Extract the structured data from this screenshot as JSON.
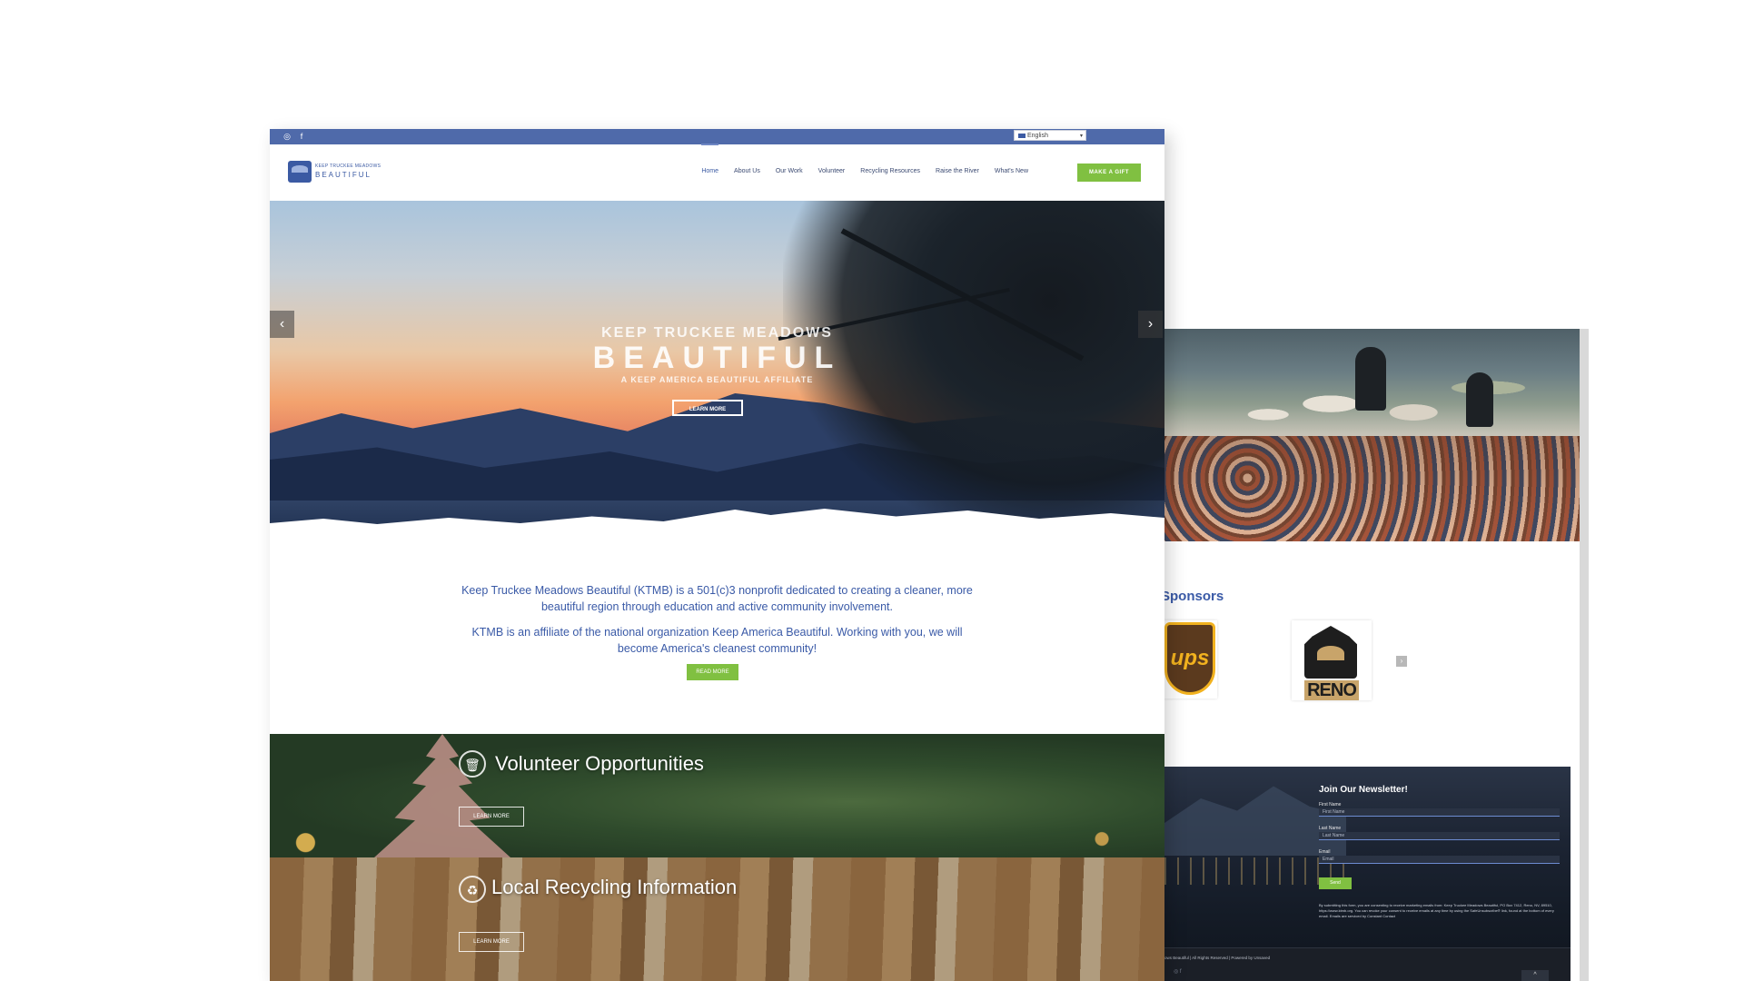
{
  "topbar": {
    "instagram_icon": "instagram-icon",
    "facebook_icon": "facebook-icon",
    "language": "English"
  },
  "logo": {
    "line1": "KEEP TRUCKEE MEADOWS",
    "line2": "BEAUTIFUL"
  },
  "nav": {
    "items": [
      "Home",
      "About Us",
      "Our Work",
      "Volunteer",
      "Recycling Resources",
      "Raise the River",
      "What's New"
    ],
    "cta": "MAKE A GIFT"
  },
  "hero": {
    "title_line1": "KEEP TRUCKEE MEADOWS",
    "title_line2": "BEAUTIFUL",
    "subtitle": "A KEEP AMERICA BEAUTIFUL AFFILIATE",
    "button": "LEARN MORE",
    "prev": "‹",
    "next": "›"
  },
  "intro": {
    "para1": "Keep Truckee Meadows Beautiful (KTMB) is a 501(c)3 nonprofit dedicated to creating a cleaner, more beautiful region through education and active community involvement.",
    "para2": "KTMB is an affiliate of the national organization Keep America Beautiful. Working with you, we will become America's cleanest community!",
    "button": "READ MORE"
  },
  "bands": {
    "volunteer": {
      "title": "Volunteer Opportunities",
      "button": "LEARN MORE",
      "icon": "trash-icon"
    },
    "recycling": {
      "title": "Local Recycling Information",
      "button": "LEARN MORE",
      "icon": "recycle-icon"
    }
  },
  "sponsors": {
    "title": "r Sponsors",
    "ups_text": "ups",
    "reno_text": "RENO",
    "arrow": "›"
  },
  "newsletter": {
    "title": "Join Our Newsletter!",
    "first_label": "First Name",
    "first_placeholder": "First Name",
    "last_label": "Last Name",
    "last_placeholder": "Last Name",
    "email_label": "Email",
    "email_placeholder": "Email",
    "send": "Send",
    "fine_print": "By submitting this form, you are consenting to receive marketing emails from: Keep Truckee Meadows Beautiful, PO Box 7412, Reno, NV, 89510, https://www.ktmb.org. You can revoke your consent to receive emails at any time by using the SafeUnsubscribe® link, found at the bottom of every email. Emails are serviced by Constant Contact"
  },
  "footer": {
    "copyright": "ows Beautiful | All Rights Reserved | Powered by Unsaved",
    "up": "^"
  },
  "colors": {
    "brand_blue": "#3a5aa7",
    "topbar_blue": "#4f6aaa",
    "accent_green": "#80c041"
  }
}
